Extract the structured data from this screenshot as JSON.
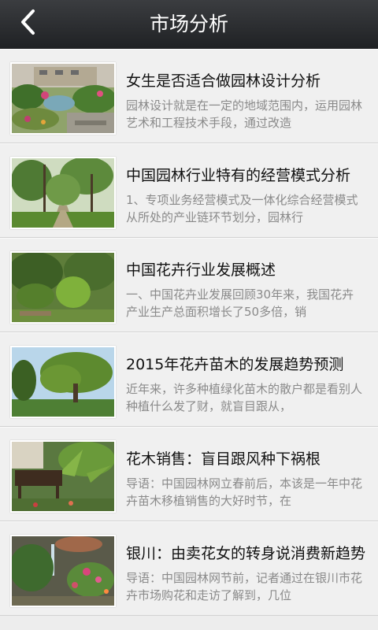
{
  "header": {
    "title": "市场分析",
    "back_icon": "chevron-left-icon"
  },
  "articles": [
    {
      "title": "女生是否适合做园林设计分析",
      "desc": "园林设计就是在一定的地域范围内，运用园林艺术和工程技术手段，通过改造"
    },
    {
      "title": "中国园林行业特有的经营模式分析",
      "desc": "1、专项业务经营模式及一体化综合经营模式从所处的产业链环节划分，园林行"
    },
    {
      "title": "中国花卉行业发展概述",
      "desc": "一、中国花卉业发展回顾30年来，我国花卉产业生产总面积增长了50多倍，销"
    },
    {
      "title": "2015年花卉苗木的发展趋势预测",
      "desc": "近年来，许多种植绿化苗木的散户都是看别人种植什么发了财，就盲目跟从，"
    },
    {
      "title": "花木销售：盲目跟风种下祸根",
      "desc": "导语：中国园林网立春前后，本该是一年中花卉苗木移植销售的大好时节，在"
    },
    {
      "title": "银川：由卖花女的转身说消费新趋势",
      "desc": "导语：中国园林网节前，记者通过在银川市花卉市场购花和走访了解到，几位"
    }
  ]
}
